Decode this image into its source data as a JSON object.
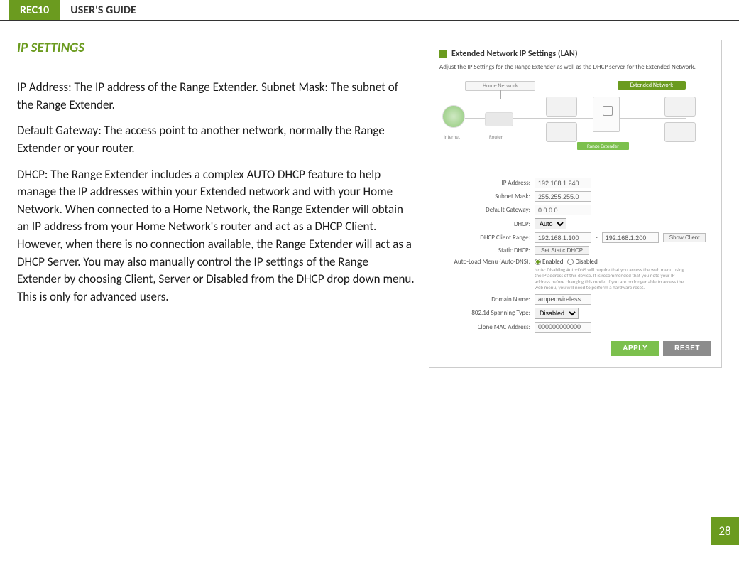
{
  "header": {
    "product": "REC10",
    "title": "USER'S GUIDE"
  },
  "section": "IP SETTINGS",
  "paragraphs": {
    "p1": "IP Address: The IP address of the Range Extender. Subnet Mask: The subnet of the Range Extender.",
    "p2": "Default Gateway: The access point to another network, normally the Range Extender or your router.",
    "p3": "DHCP: The Range Extender includes a complex AUTO DHCP feature to help manage the IP addresses within your Extended network and with your Home Network.  When connected to a Home Network, the Range Extender will obtain an IP address from your Home Network's router and act as a DHCP Client.  However, when there is no connection available, the Range Extender will act as a DHCP Server.  You may also manually control the IP settings of the Range Extender by choosing Client, Server or Disabled from the DHCP drop down menu.  This is only for advanced users."
  },
  "panel": {
    "title": "Extended Network IP Settings (LAN)",
    "subtitle": "Adjust the IP Settings for the Range Extender as well as the DHCP server for the Extended Network.",
    "diagram": {
      "home_label": "Home Network",
      "ext_label": "Extended Network",
      "internet": "Internet",
      "router": "Router",
      "range": "Range Extender"
    },
    "fields": {
      "ip_address": {
        "label": "IP Address:",
        "value": "192.168.1.240"
      },
      "subnet": {
        "label": "Subnet Mask:",
        "value": "255.255.255.0"
      },
      "gateway": {
        "label": "Default Gateway:",
        "value": "0.0.0.0"
      },
      "dhcp": {
        "label": "DHCP:",
        "value": "Auto"
      },
      "dhcp_range": {
        "label": "DHCP Client Range:",
        "from": "192.168.1.100",
        "sep": " - ",
        "to": "192.168.1.200",
        "show": "Show Client"
      },
      "static_dhcp": {
        "label": "Static DHCP:",
        "button": "Set Static DHCP"
      },
      "auto_dns": {
        "label": "Auto-Load Menu (Auto-DNS):",
        "enabled": "Enabled",
        "disabled": "Disabled",
        "note": "Note: Disabling Auto-DNS will require that you access the web menu using the IP address of this device. It is recommended that you note your IP address before changing this mode. If you are no longer able to access the web menu, you will need to perform a hardware reset."
      },
      "domain": {
        "label": "Domain Name:",
        "value": "ampedwireless"
      },
      "spanning": {
        "label": "802.1d Spanning Type:",
        "value": "Disabled"
      },
      "clone_mac": {
        "label": "Clone MAC Address:",
        "value": "000000000000"
      }
    },
    "actions": {
      "apply": "APPLY",
      "reset": "RESET"
    }
  },
  "page_number": "28"
}
